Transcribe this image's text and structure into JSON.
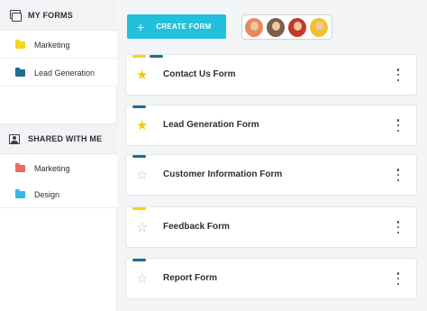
{
  "sidebar": {
    "my_forms": {
      "heading": "MY FORMS",
      "icon": "forms-icon",
      "folders": [
        {
          "label": "Marketing",
          "color": "#f5d419"
        },
        {
          "label": "Lead Generation",
          "color": "#1c6f8e"
        }
      ]
    },
    "shared": {
      "heading": "SHARED WITH ME",
      "icon": "shared-user-icon",
      "folders": [
        {
          "label": "Marketing",
          "color": "#ea6c5e"
        },
        {
          "label": "Design",
          "color": "#34b8e4"
        }
      ]
    }
  },
  "toolbar": {
    "create_label": "CREATE FORM",
    "create_icon": "plus-icon",
    "accent": "#22c0dd"
  },
  "avatars": [
    {
      "bg": "#e58a5e"
    },
    {
      "bg": "#7b5e4c"
    },
    {
      "bg": "#c0392b"
    },
    {
      "bg": "#f2c12e"
    }
  ],
  "forms": [
    {
      "title": "Contact Us Form",
      "starred": true,
      "tags": [
        "#f5d419",
        "#1c6f8e"
      ]
    },
    {
      "title": "Lead Generation Form",
      "starred": true,
      "tags": [
        "#1c6f8e"
      ]
    },
    {
      "title": "Customer Information Form",
      "starred": false,
      "tags": [
        "#1c6f8e"
      ]
    },
    {
      "title": "Feedback Form",
      "starred": false,
      "tags": [
        "#f5d419"
      ]
    },
    {
      "title": "Report Form",
      "starred": false,
      "tags": [
        "#1c6f8e"
      ]
    }
  ]
}
